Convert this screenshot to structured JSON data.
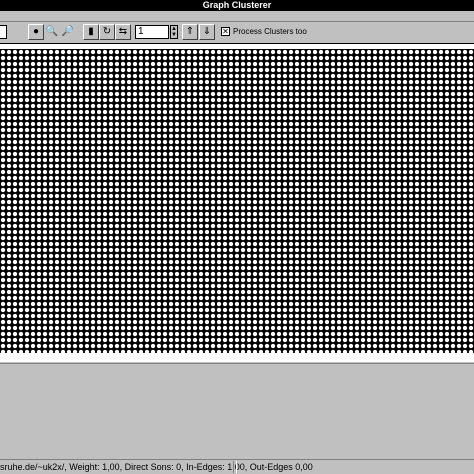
{
  "window": {
    "title": "Graph Clusterer"
  },
  "toolbar": {
    "icons": [
      "layout-icon",
      "zoom-in-icon",
      "zoom-out-icon",
      "trash-icon",
      "refresh-icon",
      "link-icon",
      "arrow-up-icon",
      "arrow-down-icon"
    ],
    "level_value": "1",
    "process_clusters_label": "Process Clusters too",
    "process_clusters_checked": true
  },
  "status": {
    "text": "sruhe.de/~uk2x/, Weight: 1,00, Direct Sons: 0, In-Edges: 1,00, Out-Edges 0,00"
  }
}
